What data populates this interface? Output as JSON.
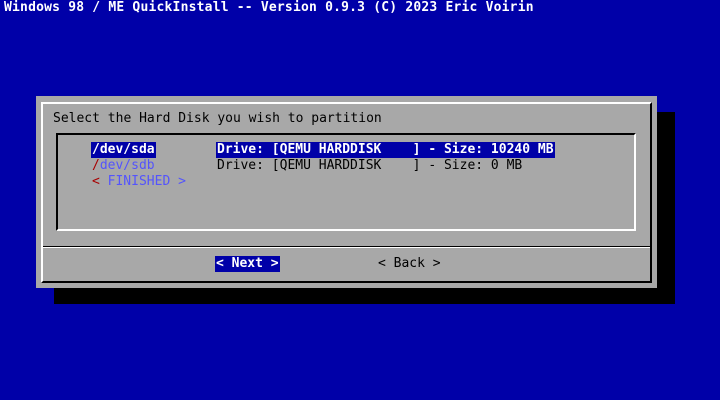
{
  "title_bar": {
    "text": "Windows 98 / ME QuickInstall -- Version 0.9.3 (C) 2023 Eric Voirin"
  },
  "dialog": {
    "prompt": "Select the Hard Disk you wish to partition",
    "items": [
      {
        "tag_first": "/",
        "tag_rest": "dev/sda",
        "description": "Drive: [QEMU HARDDISK    ] - Size: 10240 MB",
        "selected": true
      },
      {
        "tag_first": "/",
        "tag_rest": "dev/sdb",
        "description": "Drive: [QEMU HARDDISK    ] - Size: 0 MB",
        "selected": false
      },
      {
        "tag_first": "<",
        "tag_rest": " FINISHED >",
        "description": "",
        "selected": false
      }
    ],
    "buttons": {
      "next_label": "< Next >",
      "back_label": "< Back >"
    }
  },
  "colors": {
    "background": "#0000a8",
    "dialog": "#a8a8a8",
    "highlight": "#0000a8",
    "hotkey": "#a80000",
    "item_text": "#5454fc"
  }
}
